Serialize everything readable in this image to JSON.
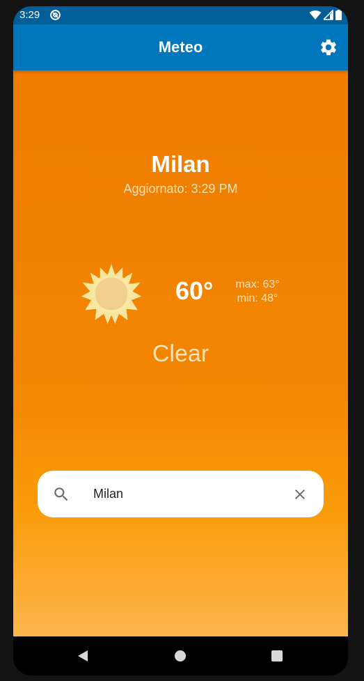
{
  "status_bar": {
    "time": "3:29",
    "icons": [
      "notification-icon",
      "wifi-icon",
      "signal-icon",
      "battery-icon"
    ]
  },
  "app_bar": {
    "title": "Meteo",
    "settings_icon": "gear-icon"
  },
  "weather": {
    "city": "Milan",
    "updated": "Aggiornato: 3:29 PM",
    "icon": "sun-icon",
    "temperature": "60°",
    "max": "max: 63°",
    "min": "min: 48°",
    "condition": "Clear"
  },
  "search": {
    "value": "Milan",
    "search_icon": "search-icon",
    "clear_icon": "close-icon"
  },
  "nav_bar": {
    "icons": [
      "back-icon",
      "home-icon",
      "recents-icon"
    ]
  },
  "colors": {
    "status_bar": "#005f99",
    "app_bar": "#0077bd",
    "background_top": "#f07d00",
    "background_bottom": "#fdb54c",
    "sun": "#f5e08e"
  }
}
